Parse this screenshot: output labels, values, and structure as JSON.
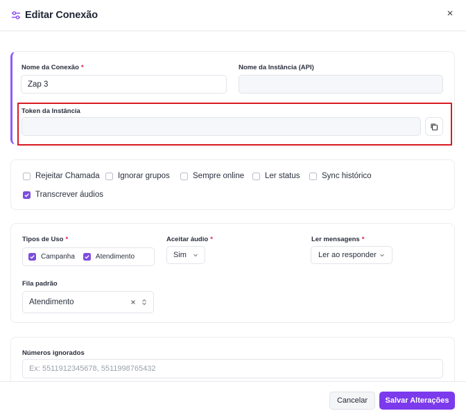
{
  "header": {
    "title": "Editar Conexão",
    "title_icon": "sliders-icon",
    "close_icon": "close-icon"
  },
  "connection": {
    "name_label": "Nome da Conexão",
    "name_required": "*",
    "name_value": "Zap 3",
    "instance_label": "Nome da Instância (API)",
    "instance_value": "",
    "token_label": "Token da Instância",
    "token_value": "",
    "copy_icon": "copy-icon"
  },
  "options": [
    {
      "label": "Rejeitar Chamada",
      "checked": false
    },
    {
      "label": "Ignorar grupos",
      "checked": false
    },
    {
      "label": "Sempre online",
      "checked": false
    },
    {
      "label": "Ler status",
      "checked": false
    },
    {
      "label": "Sync histórico",
      "checked": false
    },
    {
      "label": "Transcrever áudios",
      "checked": true
    }
  ],
  "usage": {
    "types_label": "Tipos de Uso",
    "types_required": "*",
    "types": [
      {
        "label": "Campanha",
        "checked": true
      },
      {
        "label": "Atendimento",
        "checked": true
      }
    ],
    "audio_label": "Aceitar áudio",
    "audio_required": "*",
    "audio_value": "Sim",
    "read_label": "Ler mensagens",
    "read_required": "*",
    "read_value": "Ler ao responder",
    "queue_label": "Fila padrão",
    "queue_value": "Atendimento"
  },
  "ignored": {
    "label": "Números ignorados",
    "placeholder": "Ex: 5511912345678, 5511998765432"
  },
  "footer": {
    "cancel_label": "Cancelar",
    "save_label": "Salvar Alterações"
  },
  "colors": {
    "accent": "#7c3aed",
    "checkbox": "#7c4ddd",
    "highlight": "#d71920",
    "required": "#e11d48"
  }
}
